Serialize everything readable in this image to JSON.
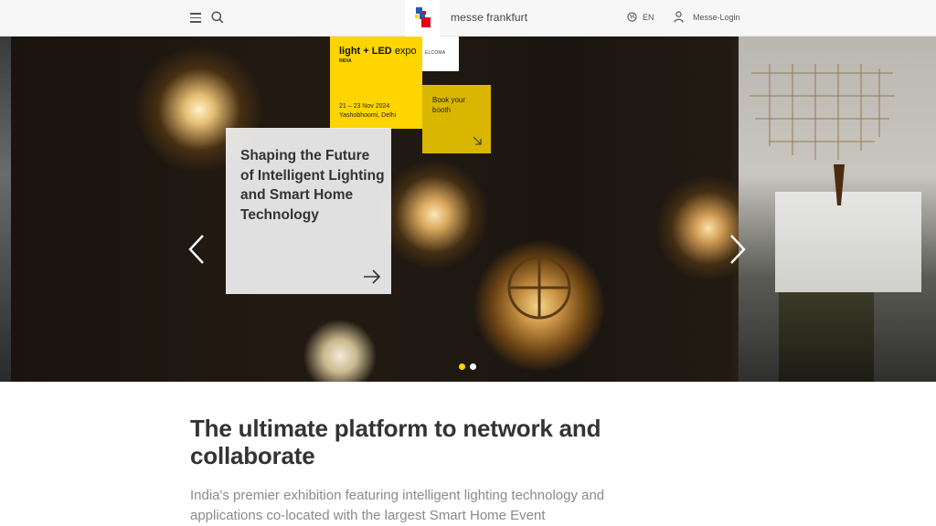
{
  "header": {
    "menu_icon": "hamburger-icon",
    "search_icon": "search-icon",
    "logo_text": "messe frankfurt",
    "language_icon": "globe-icon",
    "language": "EN",
    "login_icon": "user-icon",
    "login_label": "Messe-Login"
  },
  "hero": {
    "event_brand_main": "light + LED",
    "event_brand_suffix": "expo",
    "event_country": "INDIA",
    "event_dates": "21 – 23 Nov 2024",
    "event_venue": "Yashobhoomi, Delhi",
    "partner_logo": "ELCOMA",
    "book_label": "Book your booth",
    "teaser_title": "Shaping the Future of Intelligent Lighting and Smart Home Technology",
    "prev_icon": "chevron-left-icon",
    "next_icon": "chevron-right-icon",
    "slides_total": 2,
    "slide_active": 1
  },
  "content": {
    "headline": "The ultimate platform to network and collaborate",
    "intro": "India's premier exhibition featuring intelligent lighting technology and applications co-located with the largest Smart Home Event"
  },
  "colors": {
    "accent_yellow": "#ffd500",
    "accent_dark_yellow": "#d9b600",
    "logo_blue": "#1c5bb8",
    "logo_red": "#e2001a"
  }
}
